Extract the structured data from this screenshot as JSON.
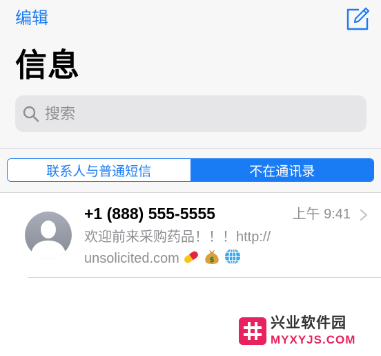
{
  "nav": {
    "edit_label": "编辑",
    "compose_icon": "compose-icon",
    "title": "信息"
  },
  "search": {
    "placeholder": "搜索",
    "value": "",
    "icon": "search-icon"
  },
  "filter": {
    "segments": [
      {
        "label": "联系人与普通短信",
        "selected": false
      },
      {
        "label": "不在通讯录",
        "selected": true
      }
    ]
  },
  "conversations": [
    {
      "sender": "+1 (888) 555-5555",
      "time": "上午 9:41",
      "preview_line1": "欢迎前来采购药品！！！http://",
      "preview_line2": "unsolicited.com",
      "emoji_icons": [
        "pill-icon",
        "money-bag-icon",
        "globe-icon"
      ],
      "avatar_icon": "person-silhouette-icon"
    }
  ],
  "watermark": {
    "logo_icon": "hash-logo-icon",
    "title": "兴业软件园",
    "domain": "MYXYJS.COM"
  },
  "colors": {
    "accent": "#1a7cf5",
    "secondary_text": "#8e8e93",
    "header_bg": "#f7f7f7",
    "watermark_brand": "#e8225e"
  }
}
